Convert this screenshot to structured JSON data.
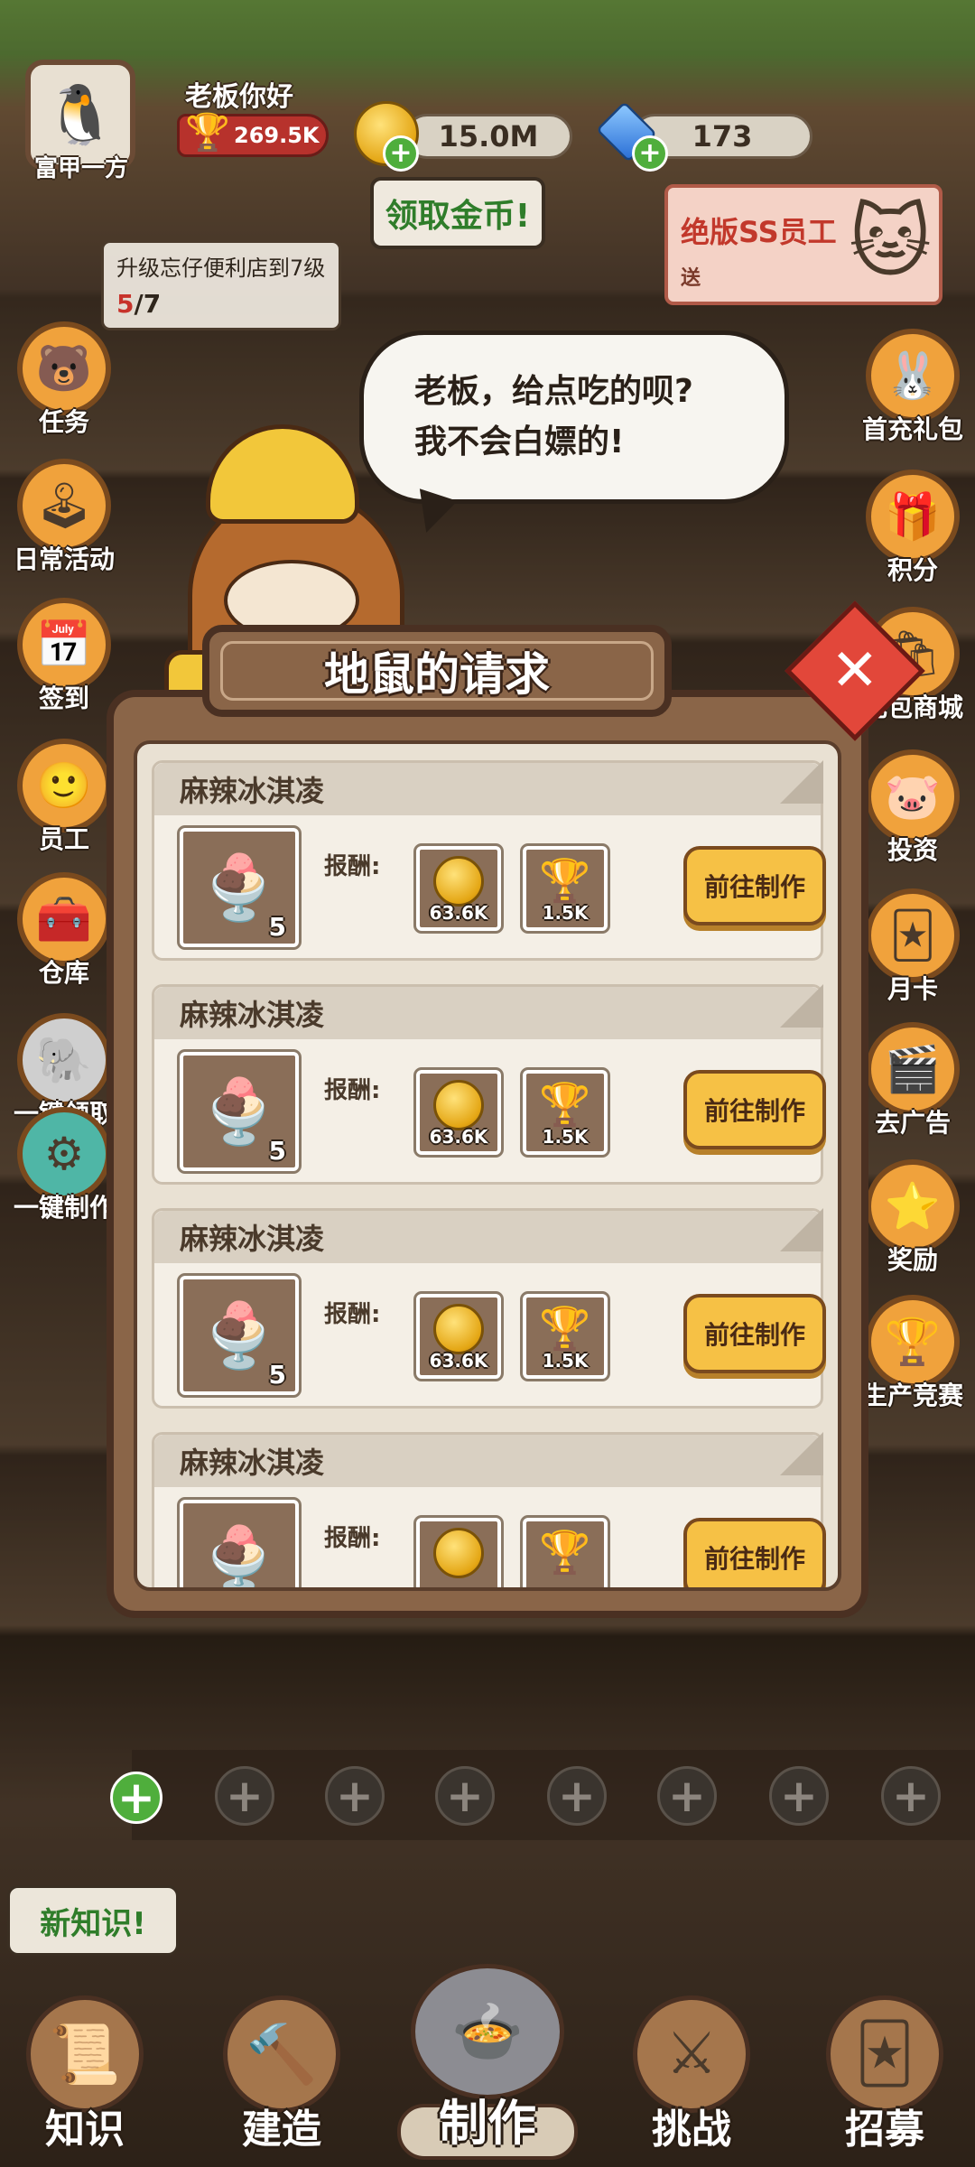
{
  "player": {
    "name": "富甲一方",
    "greeting": "老板你好",
    "trophies": "269.5K"
  },
  "resources": {
    "coins": "15.0M",
    "gems": "173",
    "collect_coins_label": "领取金币!"
  },
  "promo": {
    "title": "绝版SS员工",
    "subtitle": "送"
  },
  "upgrade_task": {
    "text": "升级忘仔便利店到7级",
    "current": "5",
    "total": "/7"
  },
  "left_menu": [
    {
      "label": "任务",
      "icon": "🐻"
    },
    {
      "label": "日常活动",
      "icon": "🕹"
    },
    {
      "label": "签到",
      "icon": "📅"
    },
    {
      "label": "员工",
      "icon": "🙂"
    },
    {
      "label": "仓库",
      "icon": "🧰"
    },
    {
      "label": "一键领取",
      "icon": "🐘"
    },
    {
      "label": "一键制作",
      "icon": "⚙"
    }
  ],
  "right_menu": [
    {
      "label": "首充礼包",
      "icon": "🐰"
    },
    {
      "label": "积分",
      "icon": "🎁"
    },
    {
      "label": "礼包商城",
      "icon": "🛍"
    },
    {
      "label": "投资",
      "icon": "🐷"
    },
    {
      "label": "月卡",
      "icon": "🃏"
    },
    {
      "label": "去广告",
      "icon": "🎬"
    },
    {
      "label": "奖励",
      "icon": "⭐"
    },
    {
      "label": "生产竞赛",
      "icon": "🏆"
    }
  ],
  "speech": {
    "line1": "老板，给点吃的呗?",
    "line2": "我不会白嫖的!"
  },
  "dialog": {
    "title": "地鼠的请求",
    "reward_label": "报酬:",
    "go_label": "前往制作",
    "requests": [
      {
        "name": "麻辣冰淇凌",
        "qty": "5",
        "coin_reward": "63.6K",
        "trophy_reward": "1.5K"
      },
      {
        "name": "麻辣冰淇凌",
        "qty": "5",
        "coin_reward": "63.6K",
        "trophy_reward": "1.5K"
      },
      {
        "name": "麻辣冰淇凌",
        "qty": "5",
        "coin_reward": "63.6K",
        "trophy_reward": "1.5K"
      },
      {
        "name": "麻辣冰淇凌",
        "qty": "",
        "coin_reward": "",
        "trophy_reward": ""
      }
    ]
  },
  "new_knowledge": "新知识!",
  "bottom_nav": [
    {
      "label": "知识",
      "icon": "📜"
    },
    {
      "label": "建造",
      "icon": "🔨"
    },
    {
      "label": "制作",
      "icon": "🍲"
    },
    {
      "label": "挑战",
      "icon": "⚔"
    },
    {
      "label": "招募",
      "icon": "🃏"
    }
  ]
}
